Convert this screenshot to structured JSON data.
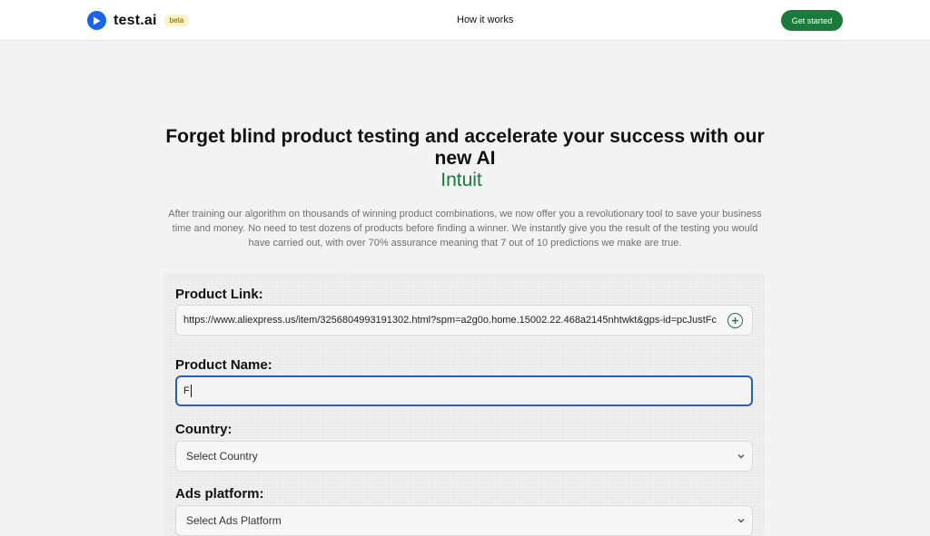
{
  "nav": {
    "brand": "test.ai",
    "badge": "beta",
    "link": "How it works",
    "cta": "Get started",
    "brand_color": "#1c63e8",
    "accent_color": "#1a7a3b"
  },
  "hero": {
    "title": "Forget blind product testing and accelerate your success with our new AI",
    "accent": "Intuit",
    "description": "After training our algorithm on thousands of winning product combinations, we now offer you a revolutionary tool to save your business time and money. No need to test dozens of products before finding a winner. We instantly give you the result of the testing you would have carried out, with over 70% assurance meaning that 7 out of 10 predictions we make are true."
  },
  "form": {
    "product_link_label": "Product Link:",
    "product_link_value": "https://www.aliexpress.us/item/3256804993191302.html?spm=a2g0o.home.15002.22.468a2145nhtwkt&gps-id=pcJustFc",
    "product_link_icon": "add-circle-icon",
    "product_name_label": "Product Name:",
    "product_name_value": "F",
    "country_label": "Country:",
    "country_selected": "Select Country",
    "ads_label": "Ads platform:",
    "ads_selected": "Select Ads Platform"
  }
}
